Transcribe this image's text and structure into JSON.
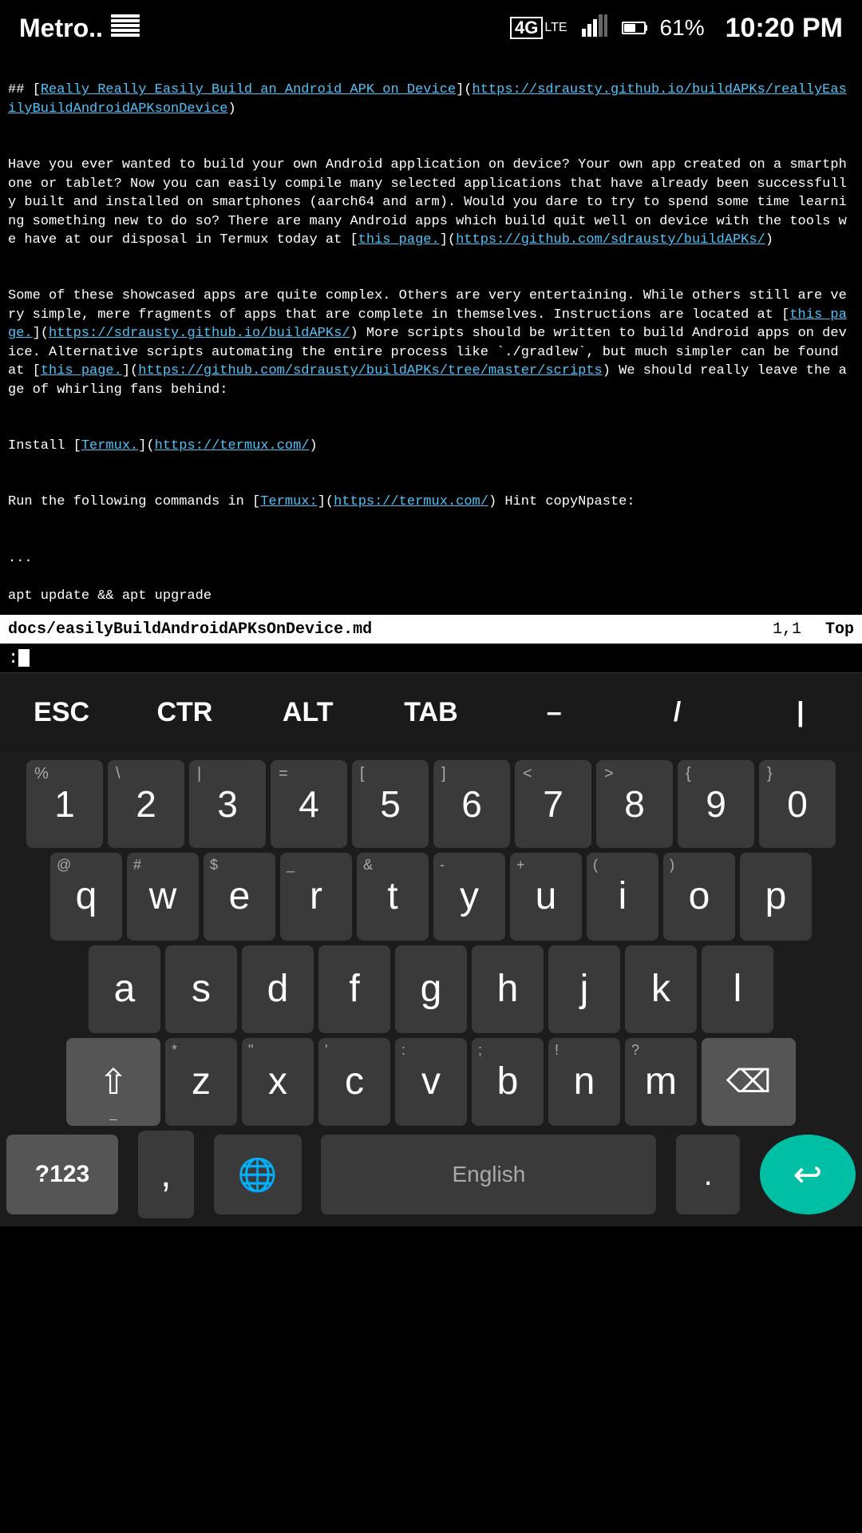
{
  "statusBar": {
    "carrier": "Metro..",
    "keyboardIcon": "⠿",
    "signal4g": "4G",
    "signalLte": "LTE",
    "batteryPercent": "61%",
    "time": "10:20 PM"
  },
  "terminal": {
    "filename": "docs/easilyBuildAndroidAPKsOnDevice.md",
    "position": "1,1",
    "topIndicator": "Top",
    "cmdPrompt": ":"
  },
  "specialKeys": {
    "esc": "ESC",
    "ctrl": "CTR",
    "alt": "ALT",
    "tab": "TAB",
    "dash": "–",
    "slash": "/",
    "pipe": "|"
  },
  "keyboard": {
    "row1": [
      {
        "main": "1",
        "alt": "%"
      },
      {
        "main": "2",
        "alt": "\\"
      },
      {
        "main": "3",
        "alt": "|"
      },
      {
        "main": "4",
        "alt": "="
      },
      {
        "main": "5",
        "alt": "["
      },
      {
        "main": "6",
        "alt": "]"
      },
      {
        "main": "7",
        "alt": "<"
      },
      {
        "main": "8",
        "alt": ">"
      },
      {
        "main": "9",
        "alt": "{"
      },
      {
        "main": "0",
        "alt": "}"
      }
    ],
    "row2": [
      {
        "main": "q",
        "alt": "@"
      },
      {
        "main": "w",
        "alt": "#"
      },
      {
        "main": "e",
        "alt": "$"
      },
      {
        "main": "r",
        "alt": "_"
      },
      {
        "main": "t",
        "alt": "&"
      },
      {
        "main": "y",
        "alt": "-"
      },
      {
        "main": "u",
        "alt": "+"
      },
      {
        "main": "i",
        "alt": "("
      },
      {
        "main": "o",
        "alt": ")"
      },
      {
        "main": "p",
        "alt": ""
      }
    ],
    "row3": [
      {
        "main": "a",
        "alt": ""
      },
      {
        "main": "s",
        "alt": ""
      },
      {
        "main": "d",
        "alt": ""
      },
      {
        "main": "f",
        "alt": ""
      },
      {
        "main": "g",
        "alt": ""
      },
      {
        "main": "h",
        "alt": ""
      },
      {
        "main": "j",
        "alt": ""
      },
      {
        "main": "k",
        "alt": ""
      },
      {
        "main": "l",
        "alt": ""
      }
    ],
    "row4": [
      {
        "main": "z",
        "alt": "*"
      },
      {
        "main": "x",
        "alt": "\""
      },
      {
        "main": "c",
        "alt": "'"
      },
      {
        "main": "v",
        "alt": ":"
      },
      {
        "main": "b",
        "alt": ";"
      },
      {
        "main": "n",
        "alt": "!"
      },
      {
        "main": "m",
        "alt": "?"
      }
    ],
    "bottomRow": {
      "symbols": "?123",
      "comma": ",",
      "spacePlaceholder": "English",
      "period": ".",
      "enterArrow": "↵"
    }
  }
}
